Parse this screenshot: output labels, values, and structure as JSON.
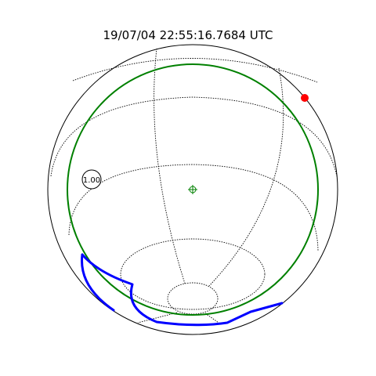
{
  "title": "19/07/04 22:55:16.7684 UTC",
  "scale_marker": {
    "label": "1.00"
  },
  "colors": {
    "limb": "#000000",
    "grid": "#000000",
    "fov_circle": "#008000",
    "center_marker": "#008000",
    "track": "#0000ff",
    "sun_marker": "#ff0000"
  }
}
